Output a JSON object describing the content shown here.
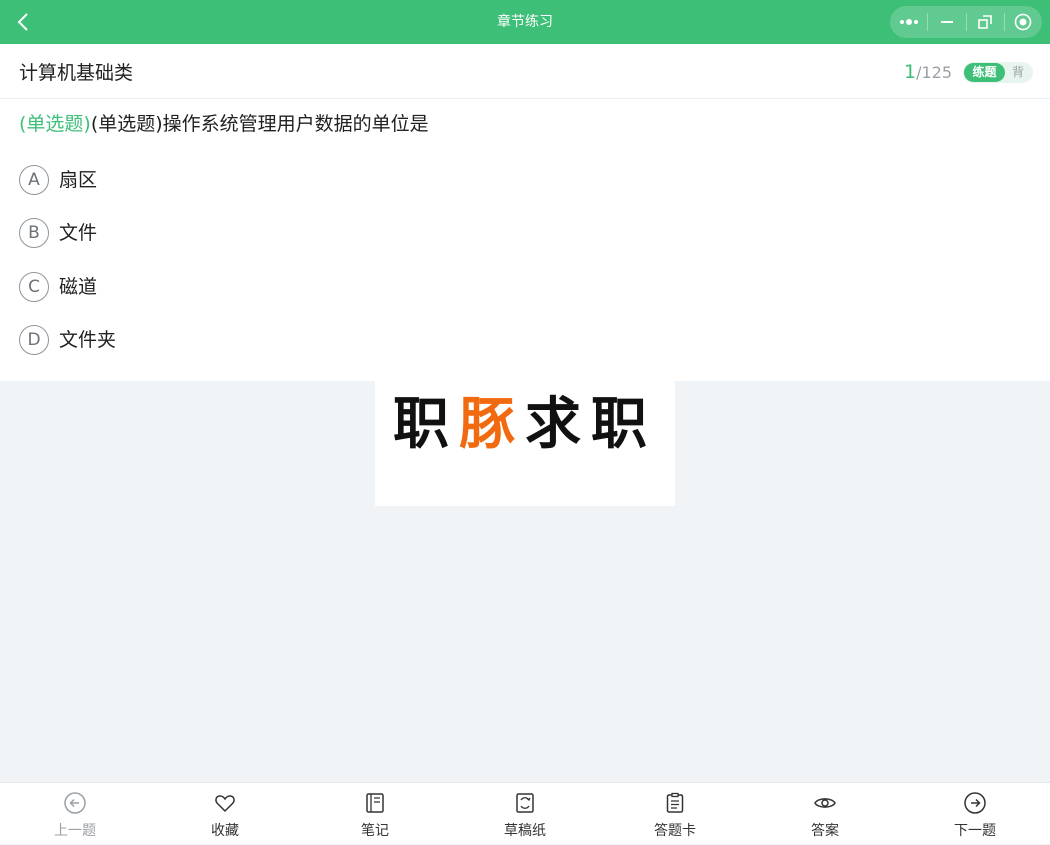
{
  "topbar": {
    "title": "章节练习"
  },
  "header": {
    "chapter": "计算机基础类",
    "current": "1",
    "separator": "/",
    "total": "125",
    "mode_practice": "练题",
    "mode_recite": "背"
  },
  "question": {
    "type_tag": "(单选题)",
    "text": "(单选题)操作系统管理用户数据的单位是"
  },
  "options": [
    {
      "letter": "A",
      "text": "扇区"
    },
    {
      "letter": "B",
      "text": "文件"
    },
    {
      "letter": "C",
      "text": "磁道"
    },
    {
      "letter": "D",
      "text": "文件夹"
    }
  ],
  "banner": {
    "logo_chars": [
      "职",
      "豚",
      "求",
      "职"
    ]
  },
  "bottom_tabs": [
    {
      "label": "上一题",
      "icon": "arrow-left-circle-icon"
    },
    {
      "label": "收藏",
      "icon": "heart-icon"
    },
    {
      "label": "笔记",
      "icon": "notebook-icon"
    },
    {
      "label": "草稿纸",
      "icon": "draft-paper-icon"
    },
    {
      "label": "答题卡",
      "icon": "clipboard-icon"
    },
    {
      "label": "答案",
      "icon": "eye-icon"
    },
    {
      "label": "下一题",
      "icon": "arrow-right-circle-icon"
    }
  ],
  "colors": {
    "brand": "#3dbf78",
    "logo_accent": "#f26a0f",
    "logo_dark": "#111111"
  }
}
